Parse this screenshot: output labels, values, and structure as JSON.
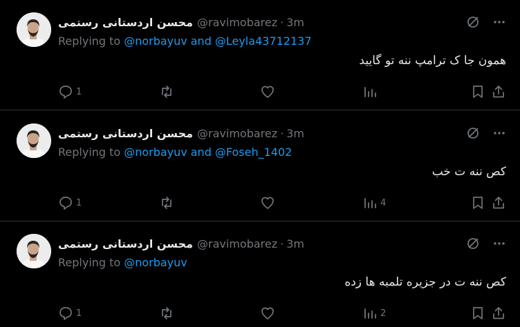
{
  "tweets": [
    {
      "author_name": "محسن اردستانی رستمی",
      "handle": "@ravimobarez",
      "separator": "·",
      "time": "3m",
      "replying_prefix": "Replying to",
      "mention_1": "@norbayuv",
      "joiner": "and",
      "mention_2": "@Leyla43712137",
      "text": "همون جا ک ترامپ ننه تو گایید",
      "reply_count": "1",
      "retweet_count": "",
      "like_count": "",
      "view_count": ""
    },
    {
      "author_name": "محسن اردستانی رستمی",
      "handle": "@ravimobarez",
      "separator": "·",
      "time": "3m",
      "replying_prefix": "Replying to",
      "mention_1": "@norbayuv",
      "joiner": "and",
      "mention_2": "@Foseh_1402",
      "text": "کص ننه ت خب",
      "reply_count": "1",
      "retweet_count": "",
      "like_count": "",
      "view_count": "4"
    },
    {
      "author_name": "محسن اردستانی رستمی",
      "handle": "@ravimobarez",
      "separator": "·",
      "time": "3m",
      "replying_prefix": "Replying to",
      "mention_1": "@norbayuv",
      "joiner": "",
      "mention_2": "",
      "text": "کص ننه ت در جزیره تلمبه ها زده",
      "reply_count": "1",
      "retweet_count": "",
      "like_count": "",
      "view_count": "2"
    }
  ],
  "icons": {
    "grok": "grok-icon",
    "more": "more-icon",
    "reply": "reply-icon",
    "retweet": "retweet-icon",
    "like": "heart-icon",
    "views": "views-icon",
    "bookmark": "bookmark-icon",
    "share": "share-icon"
  },
  "colors": {
    "background": "#000000",
    "text": "#e7e9ea",
    "muted": "#71767b",
    "link": "#1d9bf0",
    "divider": "#2f3336"
  }
}
